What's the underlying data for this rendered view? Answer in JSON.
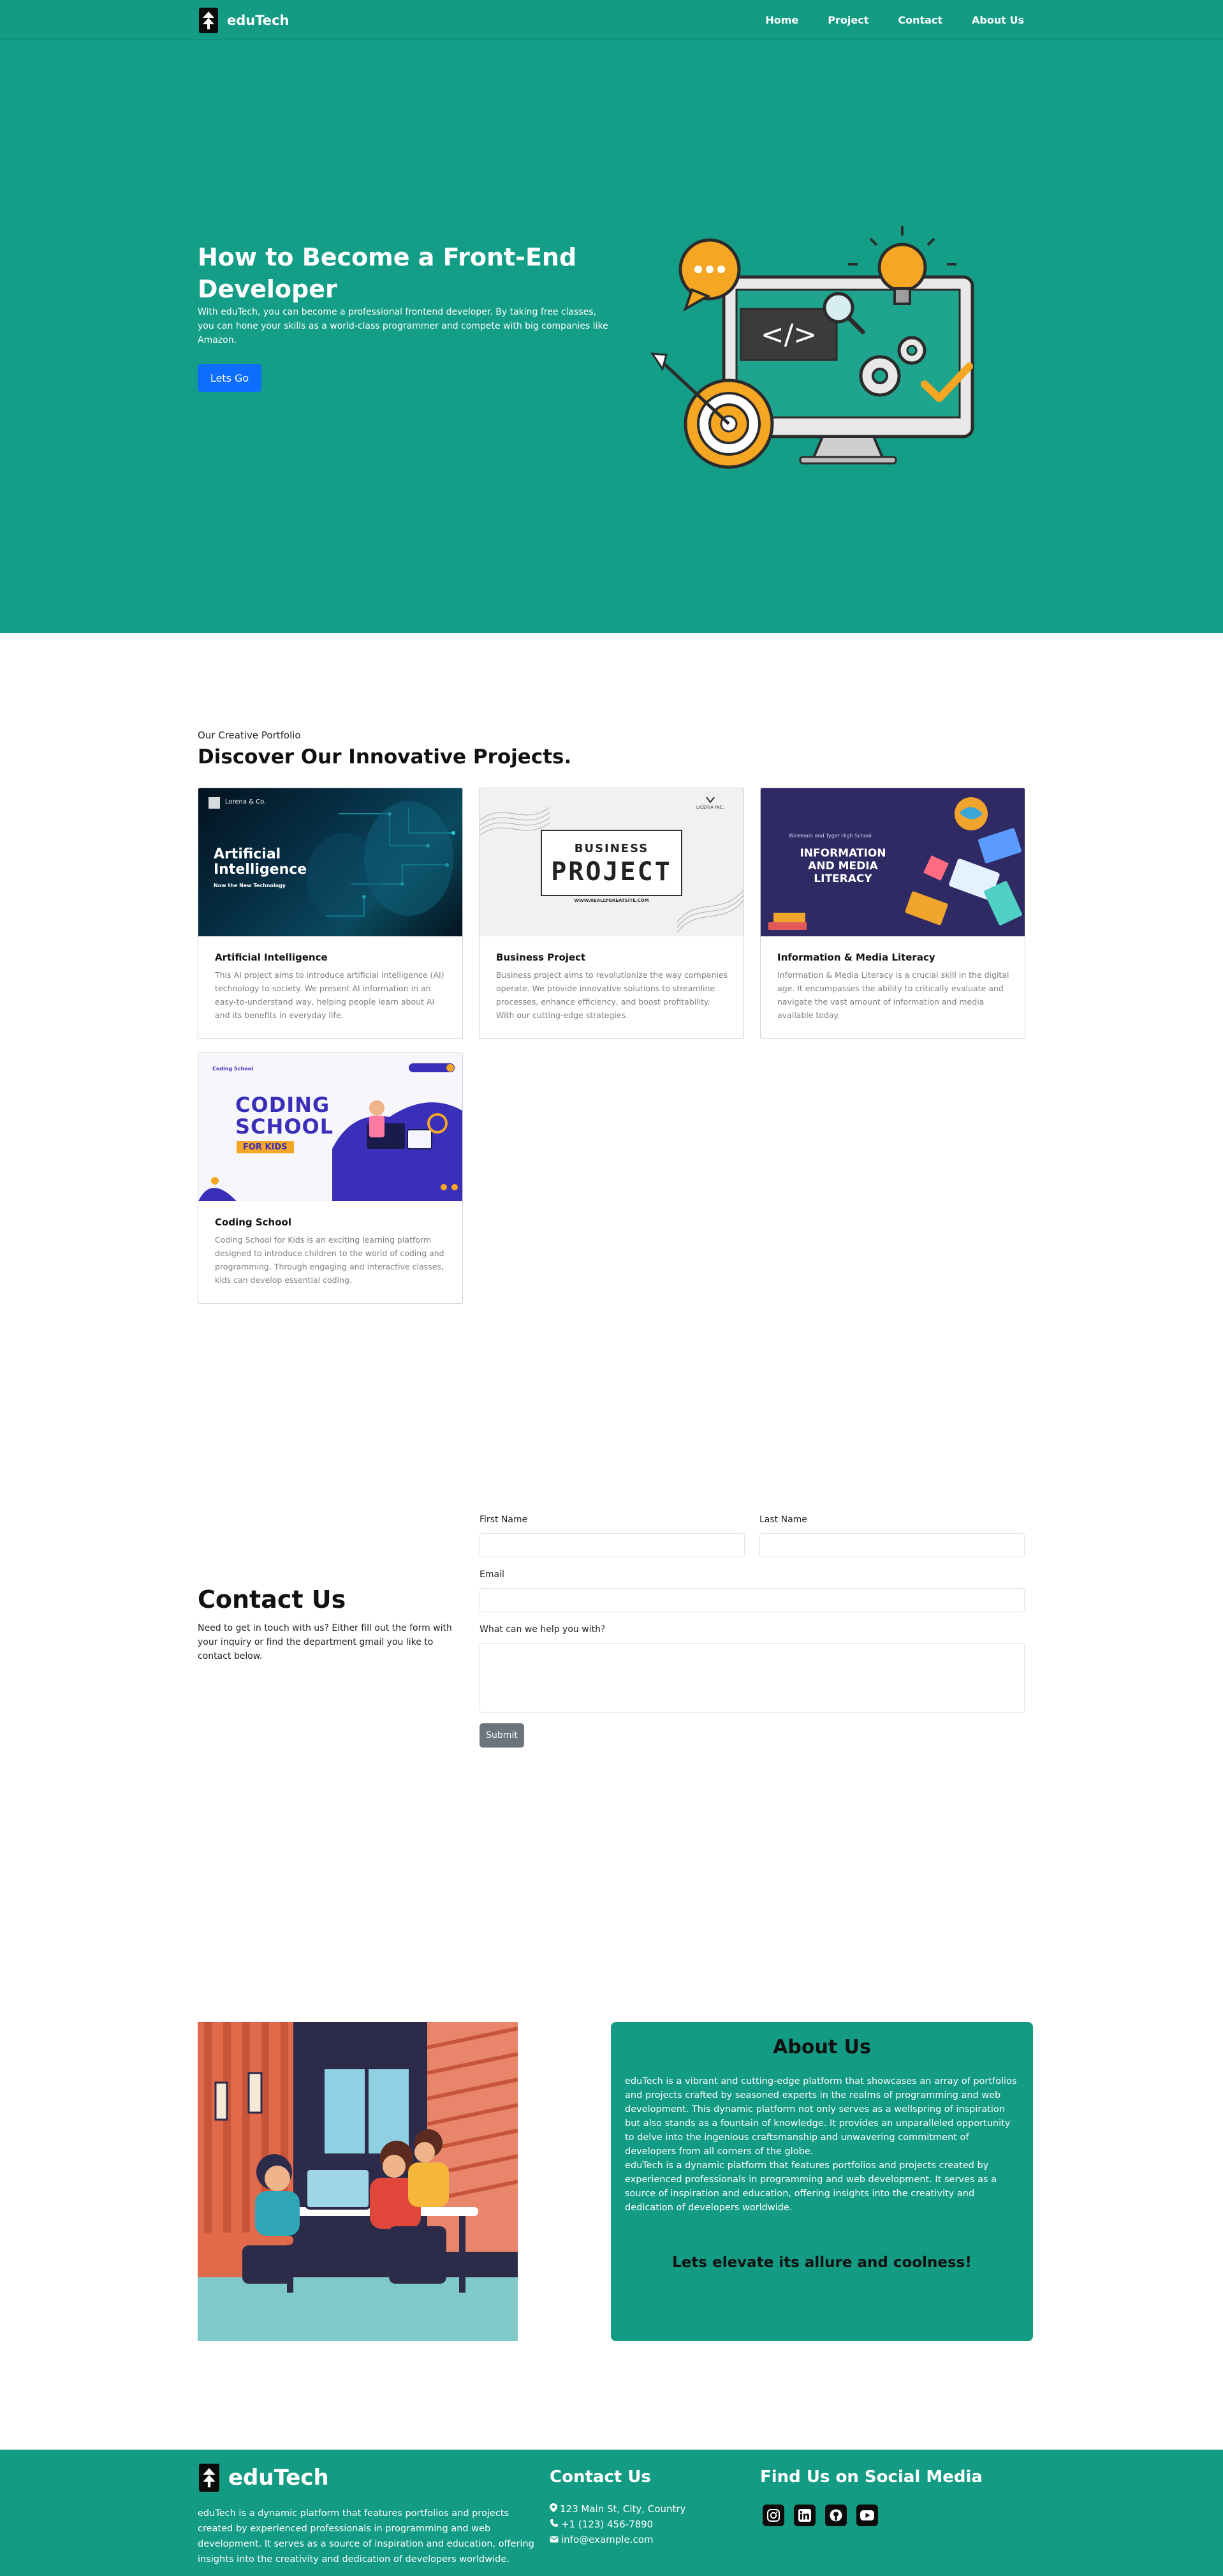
{
  "nav": {
    "brand": "eduTech",
    "links": [
      "Home",
      "Project",
      "Contact",
      "About Us"
    ]
  },
  "hero": {
    "title": "How to Become a Front-End Developer",
    "text": "With eduTech, you can become a professional frontend developer. By taking free classes, you can hone your skills as a world-class programmer and compete with big companies like Amazon.",
    "button": "Lets Go"
  },
  "portfolio": {
    "eyebrow": "Our Creative Portfolio",
    "title": "Discover Our Innovative Projects.",
    "cards": [
      {
        "title": "Artificial Intelligence",
        "text": "This AI project aims to introduce artificial intelligence (AI) technology to society. We present AI information in an easy-to-understand way, helping people learn about AI and its benefits in everyday life.",
        "image": {
          "brand": "Lorena & Co.",
          "heading": "Artificial Intelligence",
          "sub": "Now the New Technology"
        }
      },
      {
        "title": "Business Project",
        "text": "Business project aims to revolutionize the way companies operate. We provide innovative solutions to streamline processes, enhance efficiency, and boost profitability. With our cutting-edge strategies.",
        "image": {
          "brand": "LICERIA INC.",
          "line1": "BUSINESS",
          "line2": "PROJECT",
          "url": "WWW.REALLYGREATSITE.COM"
        }
      },
      {
        "title": "Information & Media Literacy",
        "text": "Information & Media Literacy is a crucial skill in the digital age. It encompasses the ability to critically evaluate and navigate the vast amount of information and media available today.",
        "image": {
          "school": "Wiremain and Tyger High School",
          "heading": "INFORMATION AND MEDIA LITERACY"
        }
      },
      {
        "title": "Coding School",
        "text": "Coding School for Kids is an exciting learning platform designed to introduce children to the world of coding and programming. Through engaging and interactive classes, kids can develop essential coding.",
        "image": {
          "logo": "Coding School",
          "line1": "CODING",
          "line2": "SCHOOL",
          "badge": "FOR KIDS"
        }
      }
    ]
  },
  "contact": {
    "title": "Contact Us",
    "text": "Need to get in touch with us? Either fill out the form with your inquiry or find the department gmail you like to contact below.",
    "first_name_label": "First Name",
    "last_name_label": "Last Name",
    "email_label": "Email",
    "message_label": "What can we help you with?",
    "submit": "Submit"
  },
  "about": {
    "title": "About Us",
    "p1": "eduTech is a vibrant and cutting-edge platform that showcases an array of portfolios and projects crafted by seasoned experts in the realms of programming and web development. This dynamic platform not only serves as a wellspring of inspiration but also stands as a fountain of knowledge. It provides an unparalleled opportunity to delve into the ingenious craftsmanship and unwavering commitment of developers from all corners of the globe.",
    "p2": "eduTech is a dynamic platform that features portfolios and projects created by experienced professionals in programming and web development. It serves as a source of inspiration and education, offering insights into the creativity and dedication of developers worldwide.",
    "tagline": "Lets elevate its allure and coolness!"
  },
  "footer": {
    "brand": "eduTech",
    "description": "eduTech is a dynamic platform that features portfolios and projects created by experienced professionals in programming and web development. It serves as a source of inspiration and education, offering insights into the creativity and dedication of developers worldwide.",
    "contact_heading": "Contact Us",
    "address": "123 Main St, City, Country",
    "phone": "+1 (123) 456-7890",
    "email": "info@example.com",
    "social_heading": "Find Us on Social Media",
    "social_icons": [
      "instagram-icon",
      "linkedin-icon",
      "github-icon",
      "youtube-icon"
    ]
  },
  "colors": {
    "primary_teal": "#139b84",
    "button_blue": "#0d6efd",
    "submit_gray": "#6c757d"
  }
}
